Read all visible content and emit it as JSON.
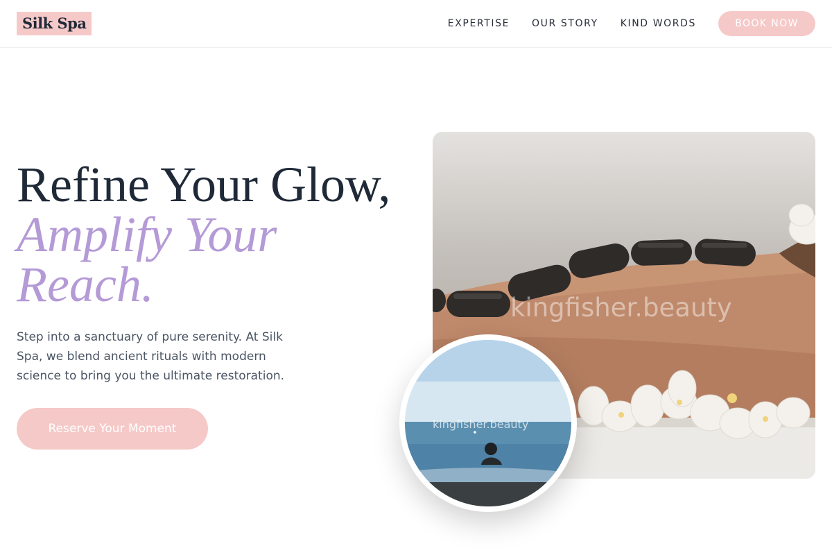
{
  "brand": {
    "name": "Silk Spa"
  },
  "nav": {
    "links": [
      "EXPERTISE",
      "OUR STORY",
      "KIND WORDS"
    ],
    "cta_label": "BOOK NOW"
  },
  "hero": {
    "headline_line1": "Refine Your Glow,",
    "headline_accent_1": "Amplify Your",
    "headline_accent_2": "Reach.",
    "subtext": "Step into a sanctuary of pure serenity. At Silk Spa, we blend ancient rituals with modern science to bring you the ultimate restoration.",
    "cta_label": "Reserve Your Moment"
  },
  "images": {
    "main_watermark": "kingfisher.beauty",
    "circle_watermark": "kingfisher.beauty"
  },
  "colors": {
    "accent_pink": "#f6c9c9",
    "accent_lavender": "#b49ad6",
    "text_dark": "#1f2937"
  }
}
